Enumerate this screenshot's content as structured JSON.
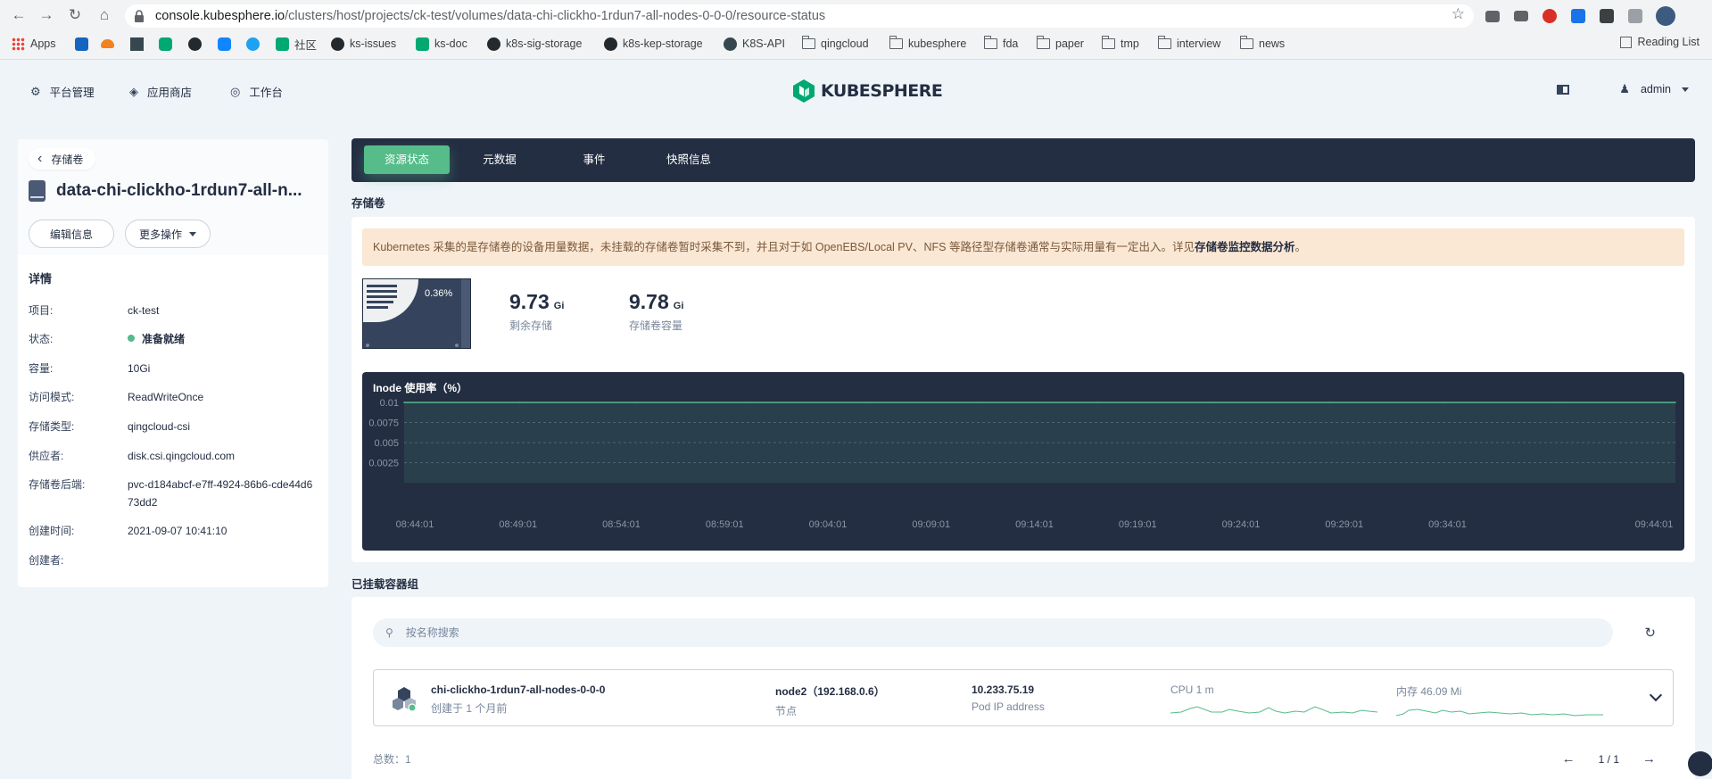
{
  "browser": {
    "url_host": "console.kubesphere.io",
    "url_path": "/clusters/host/projects/ck-test/volumes/data-chi-clickho-1rdun7-all-nodes-0-0-0/resource-status",
    "bookmarks": [
      "Apps",
      "社区",
      "ks-issues",
      "ks-doc",
      "k8s-sig-storage",
      "k8s-kep-storage",
      "K8S-API",
      "qingcloud",
      "kubesphere",
      "fda",
      "paper",
      "tmp",
      "interview",
      "news"
    ],
    "reading_list": "Reading List"
  },
  "header": {
    "nav": [
      "平台管理",
      "应用商店",
      "工作台"
    ],
    "logo": "KUBESPHERE",
    "user": "admin"
  },
  "left": {
    "back_label": "存储卷",
    "title": "data-chi-clickho-1rdun7-all-n...",
    "edit_button": "编辑信息",
    "more_button": "更多操作",
    "details_title": "详情",
    "details": [
      {
        "label": "项目:",
        "value": "ck-test"
      },
      {
        "label": "状态:",
        "value": "准备就绪"
      },
      {
        "label": "容量:",
        "value": "10Gi"
      },
      {
        "label": "访问模式:",
        "value": "ReadWriteOnce"
      },
      {
        "label": "存储类型:",
        "value": "qingcloud-csi"
      },
      {
        "label": "供应者:",
        "value": "disk.csi.qingcloud.com"
      },
      {
        "label": "存储卷后端:",
        "value": "pvc-d184abcf-e7ff-4924-86b6-cde44d673dd2"
      },
      {
        "label": "创建时间:",
        "value": "2021-09-07 10:41:10"
      },
      {
        "label": "创建者:",
        "value": ""
      }
    ],
    "status_color": "#55bc8a"
  },
  "tabs": [
    "资源状态",
    "元数据",
    "事件",
    "快照信息"
  ],
  "volume_section": {
    "title": "存储卷",
    "notice_text": "Kubernetes 采集的是存储卷的设备用量数据，未挂载的存储卷暂时采集不到，并且对于如 OpenEBS/Local PV、NFS 等路径型存储卷通常与实际用量有一定出入。详见",
    "notice_link": "存储卷监控数据分析",
    "notice_end": "。",
    "usage_percent": "0.36%",
    "free": {
      "value": "9.73",
      "unit": "Gi",
      "label": "剩余存储"
    },
    "capacity": {
      "value": "9.78",
      "unit": "Gi",
      "label": "存储卷容量"
    }
  },
  "chart_data": {
    "type": "line",
    "title": "Inode 使用率（%）",
    "x": [
      "08:44:01",
      "08:49:01",
      "08:54:01",
      "08:59:01",
      "09:04:01",
      "09:09:01",
      "09:14:01",
      "09:19:01",
      "09:24:01",
      "09:29:01",
      "09:34:01",
      "09:44:01"
    ],
    "x_ticks": [
      "08:44:01",
      "08:49:01",
      "08:54:01",
      "08:59:01",
      "09:04:01",
      "09:09:01",
      "09:14:01",
      "09:19:01",
      "09:24:01",
      "09:29:01",
      "09:34:01",
      "09:44:01"
    ],
    "y_ticks": [
      "0.01",
      "0.0075",
      "0.005",
      "0.0025"
    ],
    "ylim": [
      0,
      0.01
    ],
    "series": [
      {
        "values": [
          0.01,
          0.01,
          0.01,
          0.01,
          0.01,
          0.01,
          0.01,
          0.01,
          0.01,
          0.01,
          0.01,
          0.01
        ]
      }
    ],
    "line_color": "#55bc8a",
    "grid": true
  },
  "pods_section": {
    "title": "已挂载容器组",
    "search_placeholder": "按名称搜索",
    "pod": {
      "name": "chi-clickho-1rdun7-all-nodes-0-0-0",
      "created": "创建于 1 个月前",
      "node": "node2（192.168.0.6）",
      "node_label": "节点",
      "ip": "10.233.75.19",
      "ip_label": "Pod IP address",
      "cpu_label": "CPU 1 m",
      "mem_label": "内存 46.09 Mi"
    },
    "total_label": "总数：",
    "total": "1",
    "page": "1 / 1"
  }
}
